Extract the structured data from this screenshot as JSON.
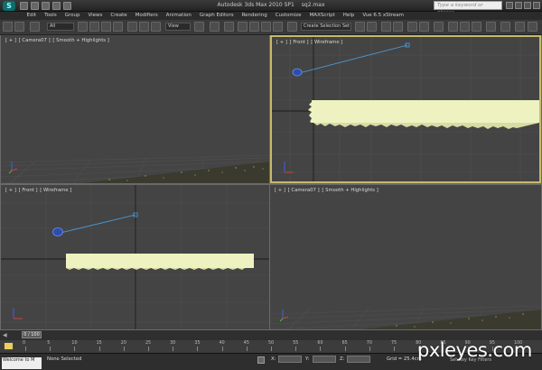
{
  "titlebar": {
    "app_title": "Autodesk 3ds Max 2010 SP1",
    "file_name": "sq2.max",
    "search_placeholder": "Type a keyword or phrase",
    "logo_glyph": "S"
  },
  "menu": [
    "Edit",
    "Tools",
    "Group",
    "Views",
    "Create",
    "Modifiers",
    "Animation",
    "Graph Editors",
    "Rendering",
    "Customize",
    "MAXScript",
    "Help",
    "Vue 6.5 xStream"
  ],
  "toolbar": {
    "selection_filter": "All",
    "reference_coord": "View",
    "named_selection": "Create Selection Set"
  },
  "viewports": [
    {
      "id": "top-left",
      "labels": [
        "[ + ]",
        "[ Camera07 ]",
        "[ Smooth + Highlights ]"
      ],
      "active": false
    },
    {
      "id": "top-right",
      "labels": [
        "[ + ]",
        "[ Front ]",
        "[ Wireframe ]"
      ],
      "active": true
    },
    {
      "id": "bottom-left",
      "labels": [
        "[ + ]",
        "[ Front ]",
        "[ Wireframe ]"
      ],
      "active": false
    },
    {
      "id": "bottom-right",
      "labels": [
        "[ + ]",
        "[ Camera07 ]",
        "[ Smooth + Highlights ]"
      ],
      "active": false
    }
  ],
  "time_slider": {
    "frame_text": "0 / 100",
    "current_frame": 0,
    "total_frames": 100
  },
  "track_ticks": [
    "0",
    "5",
    "10",
    "15",
    "20",
    "25",
    "30",
    "35",
    "40",
    "45",
    "50",
    "55",
    "60",
    "65",
    "70",
    "75",
    "80",
    "85",
    "90",
    "95",
    "100"
  ],
  "status": {
    "script_text": "Welcome to M",
    "selection_text": "None Selected",
    "x_label": "X:",
    "y_label": "Y:",
    "z_label": "Z:",
    "grid_text": "Grid = 25.4cm",
    "key_text": "Set Key   Key Filters"
  },
  "watermark": "pxleyes.com",
  "colors": {
    "active_border": "#c8b96a",
    "grass": "#eef2c0",
    "camera_line": "#4aa0e0",
    "viewport_bg": "#444444",
    "frame_red": "#dd3333"
  }
}
